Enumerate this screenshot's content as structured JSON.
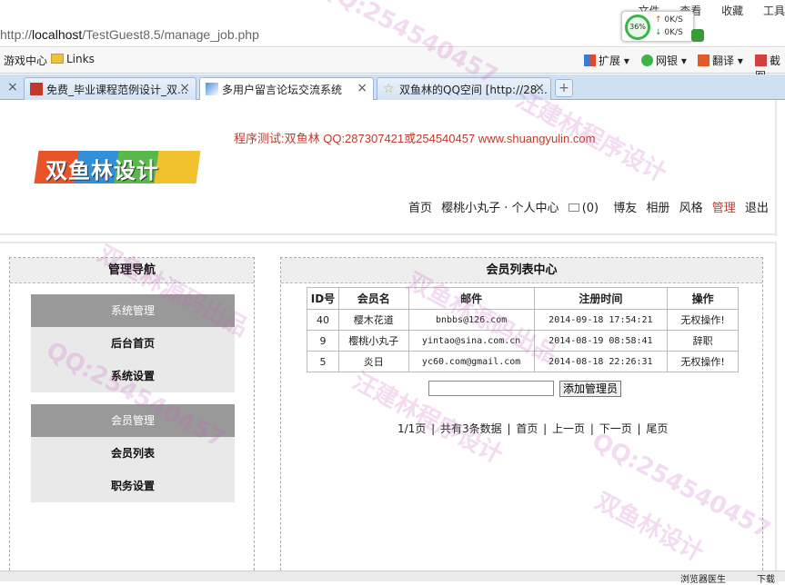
{
  "browser": {
    "menus": [
      "文件",
      "查看",
      "收藏",
      "工具"
    ],
    "url_prefix": "http://",
    "url_host": "localhost",
    "url_path": "/TestGuest8.5/manage_job.php",
    "speed": {
      "percent": "36%",
      "up": "0K/S",
      "down": "0K/S"
    },
    "favorites": {
      "games": "游戏中心",
      "links": "Links"
    },
    "toolbar": {
      "extend": "扩展",
      "netbank": "网银",
      "translate": "翻译",
      "screenshot": "截图"
    },
    "tabs": [
      {
        "title": "免费_毕业课程范例设计_双..."
      },
      {
        "title": "多用户留言论坛交流系统"
      },
      {
        "title": "双鱼林的QQ空间 [http://28..."
      }
    ],
    "status": {
      "dl": "下载",
      "img": "浏览器医生"
    }
  },
  "site": {
    "testing_notice": "程序测试:双鱼林 QQ:287307421或254540457 www.shuangyulin.com",
    "logo_text": "双鱼林设计",
    "nav": {
      "home": "首页",
      "user_center": "樱桃小丸子 · 个人中心",
      "msg_count": "(0)",
      "blog": "博友",
      "album": "相册",
      "style": "风格",
      "manage": "管理",
      "logout": "退出"
    }
  },
  "sidebar": {
    "title": "管理导航",
    "groups": [
      {
        "title": "系统管理",
        "items": [
          "后台首页",
          "系统设置"
        ]
      },
      {
        "title": "会员管理",
        "items": [
          "会员列表",
          "职务设置"
        ]
      }
    ]
  },
  "main": {
    "title": "会员列表中心",
    "columns": [
      "ID号",
      "会员名",
      "邮件",
      "注册时间",
      "操作"
    ],
    "rows": [
      {
        "id": "40",
        "name": "樱木花道",
        "email": "bnbbs@126.com",
        "time": "2014-09-18 17:54:21",
        "op": "无权操作!"
      },
      {
        "id": "9",
        "name": "樱桃小丸子",
        "email": "yintao@sina.com.cn",
        "time": "2014-08-19 08:58:41",
        "op": "辞职"
      },
      {
        "id": "5",
        "name": "炎日",
        "email": "yc60.com@gmail.com",
        "time": "2014-08-18 22:26:31",
        "op": "无权操作!"
      }
    ],
    "add_input_value": "",
    "add_button": "添加管理员",
    "pager": {
      "page": "1/1页",
      "total": "共有3条数据",
      "first": "首页",
      "prev": "上一页",
      "next": "下一页",
      "last": "尾页"
    }
  },
  "watermarks": [
    "QQ:254540457",
    "汪建林程序设计",
    "双鱼林源码出品",
    "QQ:254540457",
    "汪建林程序设计",
    "双鱼林源码出品",
    "QQ:254540457",
    "双鱼林设计"
  ],
  "colors": {
    "accent_red": "#c0392b",
    "tab_blue": "#cfe0f2",
    "nav_gray": "#999999"
  }
}
